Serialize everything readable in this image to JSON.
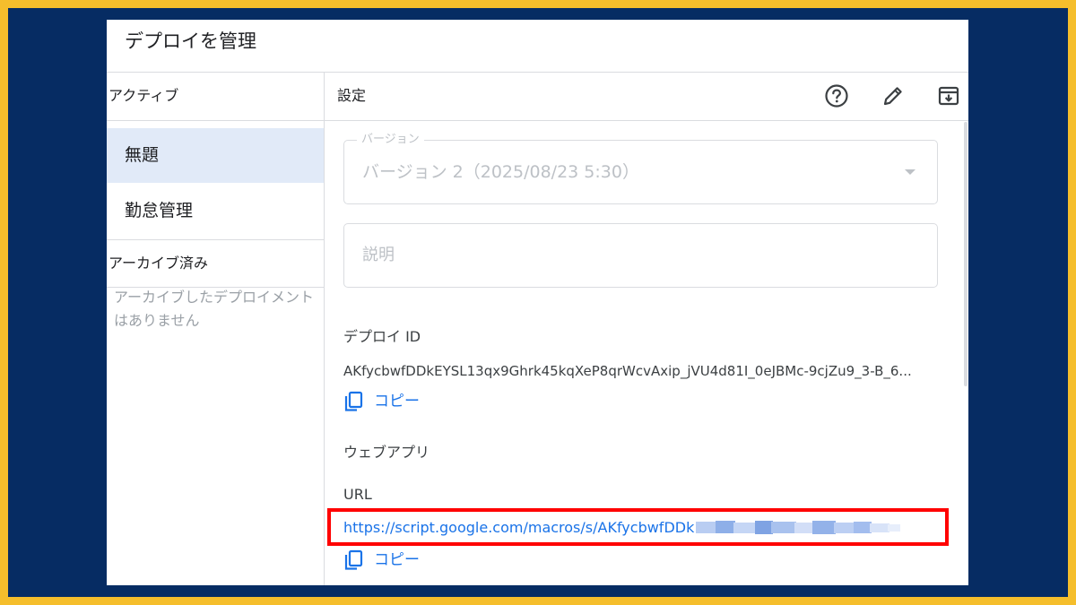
{
  "dialog": {
    "title": "デプロイを管理"
  },
  "sidebar": {
    "active_heading": "アクティブ",
    "items": [
      {
        "label": "無題",
        "selected": true
      },
      {
        "label": "勤怠管理",
        "selected": false
      }
    ],
    "archived_heading": "アーカイブ済み",
    "archived_empty": "アーカイブしたデプロイメントはありません"
  },
  "panel": {
    "heading": "設定",
    "icons": [
      "help-icon",
      "edit-icon",
      "archive-icon"
    ],
    "version": {
      "legend": "バージョン",
      "value": "バージョン 2（2025/08/23 5:30）"
    },
    "description": {
      "placeholder": "説明"
    },
    "deploy_id": {
      "label": "デプロイ ID",
      "value": "AKfycbwfDDkEYSL13qx9Ghrk45kqXeP8qrWcvAxip_jVU4d81I_0eJBMc-9cjZu9_3-B_6...",
      "copy_label": "コピー"
    },
    "web_app": {
      "heading": "ウェブアプリ",
      "url_label": "URL",
      "url_value": "https://script.google.com/macros/s/AKfycbwfDDk",
      "copy_label": "コピー"
    }
  },
  "colors": {
    "frame_border": "#F5BE2C",
    "frame_background": "#062C63",
    "selected_item": "#e1eaf8",
    "link": "#1a73e8",
    "highlight_box": "#ff0000"
  }
}
